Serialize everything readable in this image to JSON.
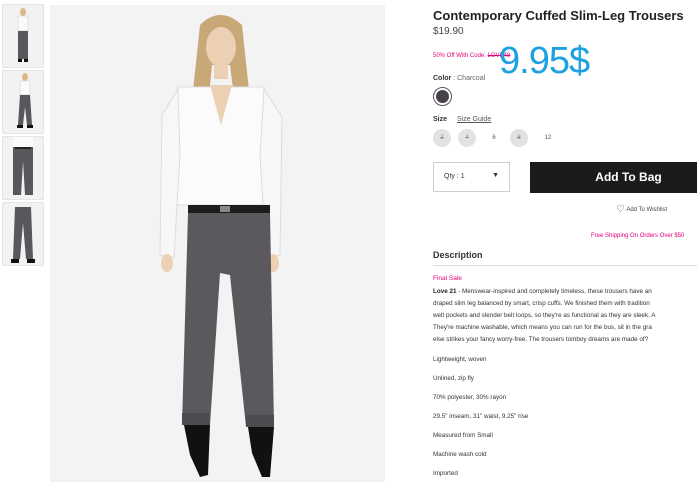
{
  "thumbnails": [
    {
      "label": "thumbnail-1"
    },
    {
      "label": "thumbnail-2"
    },
    {
      "label": "thumbnail-3"
    },
    {
      "label": "thumbnail-4"
    }
  ],
  "product": {
    "title": "Contemporary Cuffed Slim-Leg Trousers",
    "price": "$19.90",
    "promo_text": "50% Off With Code:",
    "promo_code": "LOVE48",
    "sale_overlay": "9.95$",
    "color_label": "Color",
    "color_value": ": Charcoal",
    "swatch_color": "#474249",
    "size_label": "Size",
    "size_guide": "Size Guide",
    "sizes": [
      {
        "label": "2",
        "available": false
      },
      {
        "label": "4",
        "available": false
      },
      {
        "label": "6",
        "available": true
      },
      {
        "label": "8",
        "available": false
      },
      {
        "label": "12",
        "available": true
      }
    ],
    "qty_label": "Qty : 1",
    "add_to_bag": "Add To Bag",
    "wishlist": "Add To Wishlist",
    "shipping": "Free Shipping On Orders Over $50",
    "description_heading": "Description",
    "final_sale": "Final Sale",
    "brand": "Love 21",
    "description_lines": [
      " - Menswear-inspired and completely timeless, these trousers have an",
      "draped slim leg balanced by smart, crisp cuffs. We finished them with tradition",
      "welt pockets and slender belt loops, so they're as functional as they are sleek. A",
      "They're machine washable, which means you can run for the bus, sit in the gra",
      "else strikes your fancy worry-free. The trousers tomboy dreams are made of?"
    ],
    "features": [
      "Lightweight, woven",
      "Unlined, zip fly",
      "70% polyester, 30% rayon",
      "29.5\" inseam, 31\" waist, 9.25\" rise",
      "Measured from Small",
      "Machine wash cold",
      "Imported"
    ]
  },
  "colors": {
    "accent_pink": "#e0007a",
    "overlay_blue": "#1da1e0",
    "button_dark": "#1b1b1b"
  }
}
